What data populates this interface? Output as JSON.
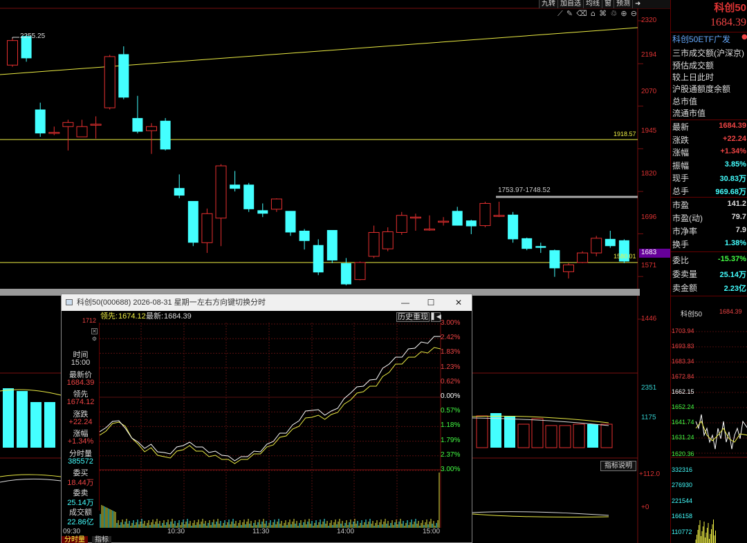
{
  "toolbar": {
    "items": [
      "九转",
      "加自选",
      "均线",
      "窗",
      "预测"
    ],
    "exit_icon": "exit-icon",
    "tool_icons": [
      "line-draw-icon",
      "pen-icon",
      "eraser-icon",
      "lock-icon",
      "home-icon",
      "trash-icon",
      "zoom-in-icon",
      "zoom-out-icon"
    ]
  },
  "price_axis": [
    "2320",
    "2194",
    "2070",
    "1945",
    "1820",
    "1696",
    "1571",
    "1446"
  ],
  "current_price_tag": "1683",
  "volume_axis": [
    "2351",
    "1175"
  ],
  "indicator_axis": [
    "+112.0",
    "+0"
  ],
  "annotations": {
    "high_label": "2255.25",
    "level_1918": "1918.57",
    "level_1580": "1580.01",
    "range_label": "1753.97-1748.52"
  },
  "chart_data": {
    "type": "candlestick",
    "candles": [
      {
        "o": 2190,
        "c": 2262,
        "h": 2268,
        "l": 2185
      },
      {
        "o": 2275,
        "c": 2210,
        "h": 2280,
        "l": 2200
      },
      {
        "o": 2060,
        "c": 1990,
        "h": 2080,
        "l": 1980
      },
      {
        "o": 1993,
        "c": 1993,
        "h": 2010,
        "l": 1985
      },
      {
        "o": 2010,
        "c": 2022,
        "h": 2030,
        "l": 1940
      },
      {
        "o": 1980,
        "c": 2010,
        "h": 2030,
        "l": 1980
      },
      {
        "o": 2017,
        "c": 2017,
        "h": 2040,
        "l": 1975
      },
      {
        "o": 2065,
        "c": 2215,
        "h": 2220,
        "l": 2060
      },
      {
        "o": 2222,
        "c": 2095,
        "h": 2245,
        "l": 2090
      },
      {
        "o": 2035,
        "c": 1995,
        "h": 2100,
        "l": 1990
      },
      {
        "o": 1998,
        "c": 2010,
        "h": 2020,
        "l": 1930
      },
      {
        "o": 2027,
        "c": 1943,
        "h": 2035,
        "l": 1940
      },
      {
        "o": 1830,
        "c": 1808,
        "h": 1870,
        "l": 1800
      },
      {
        "o": 1792,
        "c": 1670,
        "h": 1790,
        "l": 1660
      },
      {
        "o": 1670,
        "c": 1755,
        "h": 1770,
        "l": 1640
      },
      {
        "o": 1742,
        "c": 1895,
        "h": 1900,
        "l": 1660
      },
      {
        "o": 1840,
        "c": 1828,
        "h": 1880,
        "l": 1820
      },
      {
        "o": 1840,
        "c": 1768,
        "h": 1845,
        "l": 1760
      },
      {
        "o": 1765,
        "c": 1755,
        "h": 1785,
        "l": 1745
      },
      {
        "o": 1768,
        "c": 1798,
        "h": 1800,
        "l": 1760
      },
      {
        "o": 1763,
        "c": 1700,
        "h": 1760,
        "l": 1690
      },
      {
        "o": 1705,
        "c": 1675,
        "h": 1710,
        "l": 1650
      },
      {
        "o": 1663,
        "c": 1583,
        "h": 1680,
        "l": 1575
      },
      {
        "o": 1707,
        "c": 1618,
        "h": 1705,
        "l": 1610
      },
      {
        "o": 1610,
        "c": 1548,
        "h": 1625,
        "l": 1545
      },
      {
        "o": 1562,
        "c": 1612,
        "h": 1615,
        "l": 1560
      },
      {
        "o": 1630,
        "c": 1700,
        "h": 1720,
        "l": 1625
      },
      {
        "o": 1652,
        "c": 1702,
        "h": 1715,
        "l": 1645
      },
      {
        "o": 1700,
        "c": 1750,
        "h": 1760,
        "l": 1693
      },
      {
        "o": 1745,
        "c": 1745,
        "h": 1755,
        "l": 1705
      },
      {
        "o": 1710,
        "c": 1710,
        "h": 1750,
        "l": 1705
      },
      {
        "o": 1733,
        "c": 1733,
        "h": 1745,
        "l": 1720
      },
      {
        "o": 1763,
        "c": 1720,
        "h": 1775,
        "l": 1720
      },
      {
        "o": 1735,
        "c": 1718,
        "h": 1737,
        "l": 1695
      },
      {
        "o": 1720,
        "c": 1785,
        "h": 1790,
        "l": 1715
      },
      {
        "o": 1750,
        "c": 1750,
        "h": 1790,
        "l": 1745
      },
      {
        "o": 1752,
        "c": 1680,
        "h": 1760,
        "l": 1670
      },
      {
        "o": 1683,
        "c": 1652,
        "h": 1685,
        "l": 1648
      },
      {
        "o": 1660,
        "c": 1655,
        "h": 1670,
        "l": 1640
      },
      {
        "o": 1648,
        "c": 1595,
        "h": 1650,
        "l": 1570
      },
      {
        "o": 1585,
        "c": 1605,
        "h": 1610,
        "l": 1565
      },
      {
        "o": 1612,
        "c": 1640,
        "h": 1645,
        "l": 1610
      },
      {
        "o": 1640,
        "c": 1683,
        "h": 1690,
        "l": 1630
      },
      {
        "o": 1681,
        "c": 1660,
        "h": 1705,
        "l": 1655
      },
      {
        "o": 1677,
        "c": 1615,
        "h": 1680,
        "l": 1610
      }
    ],
    "ylim": [
      1420,
      2340
    ]
  },
  "right_panel": {
    "title": "科创50",
    "price": "1684.39",
    "etf": "科创50ETF广发",
    "lines": [
      "三市成交额(沪深京)",
      "预估成交额",
      "较上日此时",
      "沪股通额度余额",
      "总市值",
      "流通市值"
    ],
    "quotes": [
      {
        "k": "最新",
        "v": "1684.39",
        "c": "#e44"
      },
      {
        "k": "涨跌",
        "v": "+22.24",
        "c": "#e44"
      },
      {
        "k": "涨幅",
        "v": "+1.34%",
        "c": "#e44"
      },
      {
        "k": "振幅",
        "v": "3.85%",
        "c": "#4ff"
      },
      {
        "k": "现手",
        "v": "30.83万",
        "c": "#4ff"
      },
      {
        "k": "总手",
        "v": "969.68万",
        "c": "#4ff"
      }
    ],
    "valuation": [
      {
        "k": "市盈",
        "v": "141.2",
        "c": "#ddd"
      },
      {
        "k": "市盈(动)",
        "v": "79.7",
        "c": "#ddd"
      },
      {
        "k": "市净率",
        "v": "7.9",
        "c": "#ddd"
      },
      {
        "k": "换手",
        "v": "1.38%",
        "c": "#4ff"
      }
    ],
    "orders": [
      {
        "k": "委比",
        "v": "-15.37%",
        "c": "#4f4"
      },
      {
        "k": "委卖量",
        "v": "25.14万",
        "c": "#4ff"
      },
      {
        "k": "卖金额",
        "v": "2.23亿",
        "c": "#4ff"
      }
    ],
    "mini_name": "科创50",
    "mini_price": "1684.39",
    "mini_axis": [
      "1703.94",
      "1693.83",
      "1683.34",
      "1672.84",
      "1662.15",
      "1652.24",
      "1641.74",
      "1631.24",
      "1620.36",
      "332316",
      "276930",
      "221544",
      "166158",
      "110772"
    ]
  },
  "popup": {
    "title": "科创50(000688) 2026-08-31 星期一",
    "hint": "左右方向键切换分时",
    "info_lead_label": "领先:",
    "info_lead_value": "1674.12",
    "info_last_label": "最新:",
    "info_last_value": "1684.39",
    "left_value": "1712",
    "replay": "历史重现",
    "fields": [
      {
        "k": "时间",
        "v": "15:00",
        "vc": "#ddd"
      },
      {
        "k": "最新价",
        "v": "1684.39",
        "vc": "#e44"
      },
      {
        "k": "领先",
        "v": "1674.12",
        "vc": "#e44"
      },
      {
        "k": "涨跌",
        "v": "+22.24",
        "vc": "#e44"
      },
      {
        "k": "涨幅",
        "v": "+1.34%",
        "vc": "#e44"
      },
      {
        "k": "分时量",
        "v": "385572",
        "vc": "#4ff"
      },
      {
        "k": "委买",
        "v": "18.44万",
        "vc": "#e44"
      },
      {
        "k": "委卖",
        "v": "25.14万",
        "vc": "#4ff"
      },
      {
        "k": "成交额",
        "v": "22.86亿",
        "vc": "#4ff"
      }
    ],
    "pct_axis": [
      "3.00%",
      "2.42%",
      "1.83%",
      "1.23%",
      "0.62%",
      "0.00%",
      "0.57%",
      "1.18%",
      "1.79%",
      "2.37%",
      "3.00%"
    ],
    "times": [
      "09:30",
      "10:30",
      "11:30",
      "14:00",
      "15:00"
    ],
    "tabs": [
      "分时量",
      "指标"
    ]
  },
  "indicator_button": "指标说明"
}
